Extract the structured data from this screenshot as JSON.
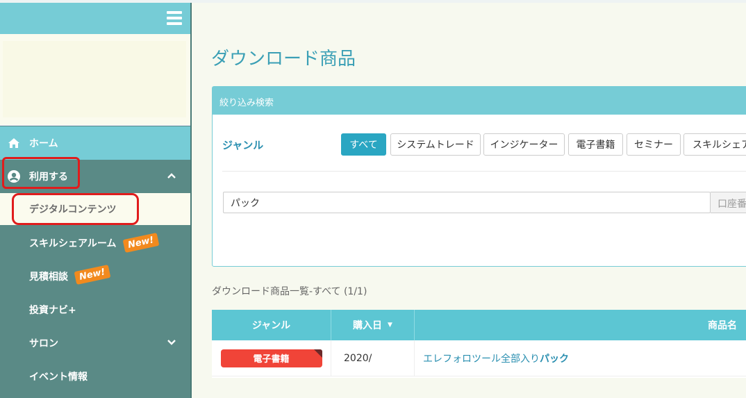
{
  "sidebar": {
    "home_label": "ホーム",
    "use_label": "利用する",
    "digital_label": "デジタルコンテンツ",
    "skillshare_label": "スキルシェアルーム",
    "estimate_label": "見積相談",
    "invest_label": "投資ナビ+",
    "salon_label": "サロン",
    "event_label": "イベント情報",
    "new_badge": "New!"
  },
  "main": {
    "title": "ダウンロード商品",
    "filter_header": "絞り込み検索",
    "genre_label": "ジャンル",
    "genres": [
      "すべて",
      "システムトレード",
      "インジケーター",
      "電子書籍",
      "セミナー",
      "スキルシェア"
    ],
    "active_genre": "すべて",
    "search_value": "パック",
    "account_placeholder": "口座番",
    "list_caption": "ダウンロード商品一覧-すべて (1/1)"
  },
  "table": {
    "columns": [
      "ジャンル",
      "購入日",
      "商品名"
    ],
    "sort_indicator": "▼",
    "rows": [
      {
        "genre": "電子書籍",
        "date": "2020/",
        "name_prefix": "エレフォロツール全部入り",
        "name_bold": "パック"
      }
    ]
  },
  "colors": {
    "accent": "#76ccd6",
    "sidebar": "#5a8a86",
    "button_active": "#2aa6c2",
    "tag_red": "#f04438",
    "badge_orange": "#f28a1e",
    "highlight_red": "#e01c1c"
  }
}
